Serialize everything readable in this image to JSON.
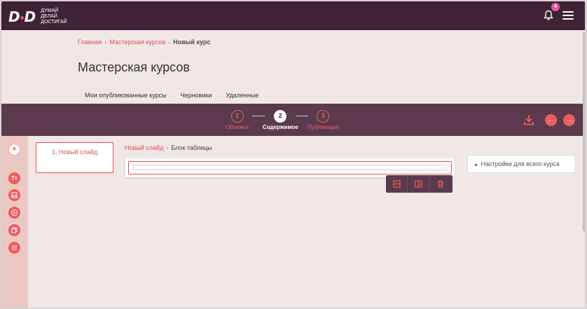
{
  "header": {
    "logo_mark_left": "D",
    "logo_mark_right": "D",
    "logo_text_1": "ДУМАЙ",
    "logo_text_2": "ДЕЛАЙ",
    "logo_text_3": "ДОСТИГАЙ",
    "notifications_count": "4",
    "icons": [
      "bell-icon",
      "menu-icon"
    ]
  },
  "breadcrumb": {
    "home": "Главная",
    "workshop": "Мастерская курсов",
    "current": "Новый курс",
    "sep": "›"
  },
  "page_title": "Мастерская курсов",
  "tabs": [
    "Мои опубликованные курсы",
    "Черновики",
    "Удаленные"
  ],
  "active_tab": "Черновики",
  "stepper": {
    "steps": [
      {
        "num": "1",
        "label": "Обложка",
        "state": "inactive"
      },
      {
        "num": "2",
        "label": "Содержимое",
        "state": "active"
      },
      {
        "num": "3",
        "label": "Публикация",
        "state": "inactive"
      }
    ],
    "prev_arrow": "←",
    "next_arrow": "→"
  },
  "toolbar": {
    "add": "+",
    "text_tool": "Tт",
    "icons": [
      "add-icon",
      "text-icon",
      "image-icon",
      "video-icon",
      "gallery-icon",
      "grid-icon"
    ]
  },
  "slides": [
    "1. Новый слайд"
  ],
  "content_breadcrumb": {
    "slide": "Новый слайд",
    "sep": "›",
    "current": "Блок таблицы"
  },
  "settings_button": "Настройки для всего курса",
  "colors": {
    "header_bg": "#3f2236",
    "stepper_bg": "#5b3a4e",
    "accent": "#ee5d5d",
    "link": "#e0524f",
    "page_bg": "#f0e7e6",
    "sidebar_bg": "#ecc8c3",
    "badge": "#e256a0"
  }
}
